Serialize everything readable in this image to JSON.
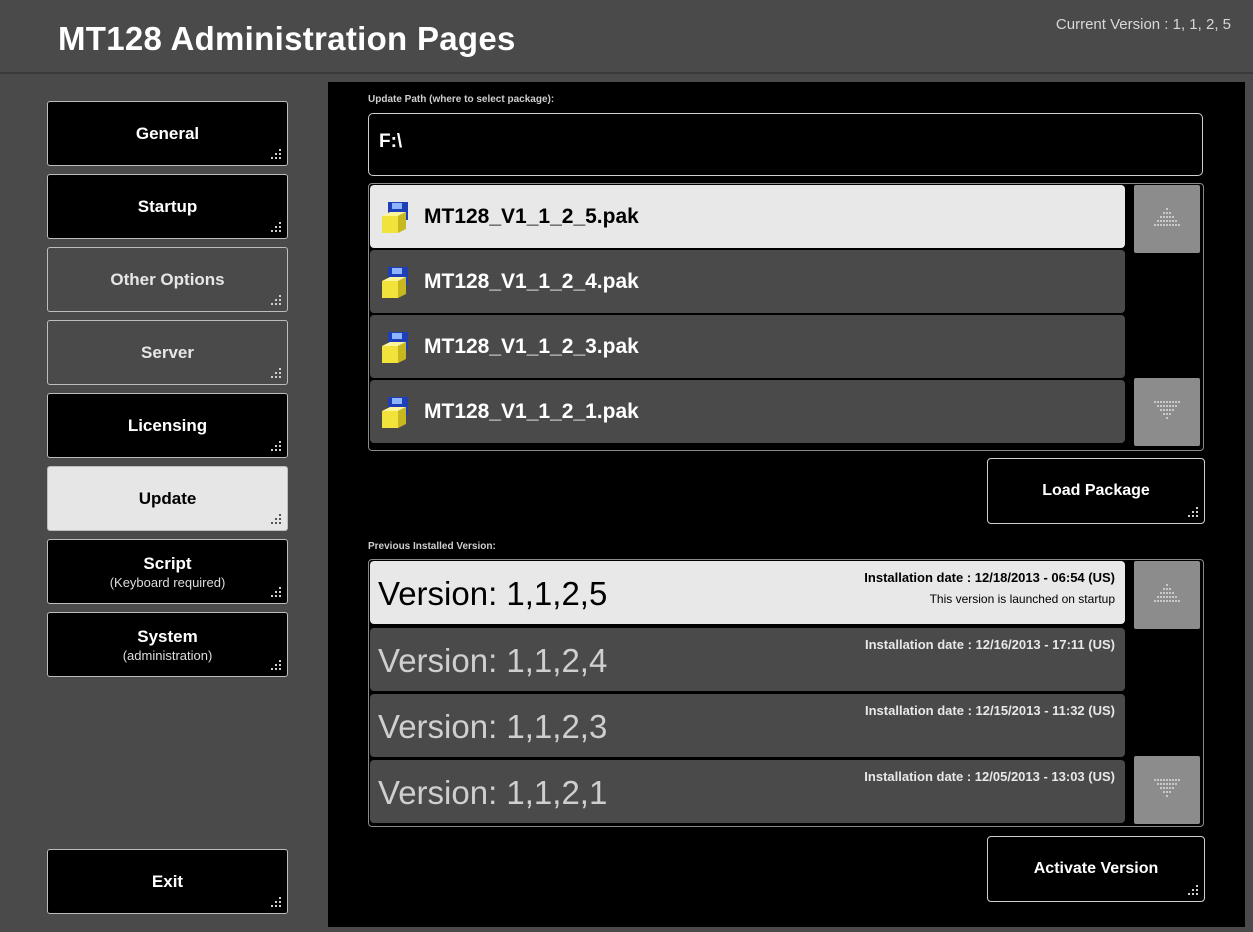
{
  "header": {
    "title": "MT128 Administration Pages",
    "current_version": "Current Version : 1, 1, 2, 5"
  },
  "sidebar": {
    "items": [
      {
        "label": "General",
        "sub": "",
        "state": "normal"
      },
      {
        "label": "Startup",
        "sub": "",
        "state": "normal"
      },
      {
        "label": "Other Options",
        "sub": "",
        "state": "disabled"
      },
      {
        "label": "Server",
        "sub": "",
        "state": "disabled"
      },
      {
        "label": "Licensing",
        "sub": "",
        "state": "normal"
      },
      {
        "label": "Update",
        "sub": "",
        "state": "active"
      },
      {
        "label": "Script",
        "sub": "(Keyboard required)",
        "state": "normal"
      },
      {
        "label": "System",
        "sub": "(administration)",
        "state": "normal"
      }
    ],
    "exit_label": "Exit"
  },
  "update": {
    "path_label": "Update Path (where to select package):",
    "path_value": "F:\\",
    "packages": [
      {
        "name": "MT128_V1_1_2_5.pak",
        "selected": true
      },
      {
        "name": "MT128_V1_1_2_4.pak",
        "selected": false
      },
      {
        "name": "MT128_V1_1_2_3.pak",
        "selected": false
      },
      {
        "name": "MT128_V1_1_2_1.pak",
        "selected": false
      }
    ],
    "load_label": "Load Package",
    "previous_label": "Previous Installed Version:",
    "versions": [
      {
        "name": "Version: 1,1,2,5",
        "date": "Installation date : 12/18/2013 - 06:54 (US)",
        "note": "This version is launched on startup",
        "selected": true
      },
      {
        "name": "Version: 1,1,2,4",
        "date": "Installation date : 12/16/2013 - 17:11 (US)",
        "note": "",
        "selected": false
      },
      {
        "name": "Version: 1,1,2,3",
        "date": "Installation date : 12/15/2013 - 11:32 (US)",
        "note": "",
        "selected": false
      },
      {
        "name": "Version: 1,1,2,1",
        "date": "Installation date : 12/05/2013 - 13:03 (US)",
        "note": "",
        "selected": false
      }
    ],
    "activate_label": "Activate Version"
  },
  "icons": {
    "package": "floppy-disk-icon",
    "scroll_up": "scroll-up-icon",
    "scroll_down": "scroll-down-icon",
    "grip": "resize-grip-icon"
  },
  "colors": {
    "background": "#4a4a4a",
    "panel": "#000000",
    "selected_row": "#e8e8e8",
    "row": "#4a4a4a"
  }
}
